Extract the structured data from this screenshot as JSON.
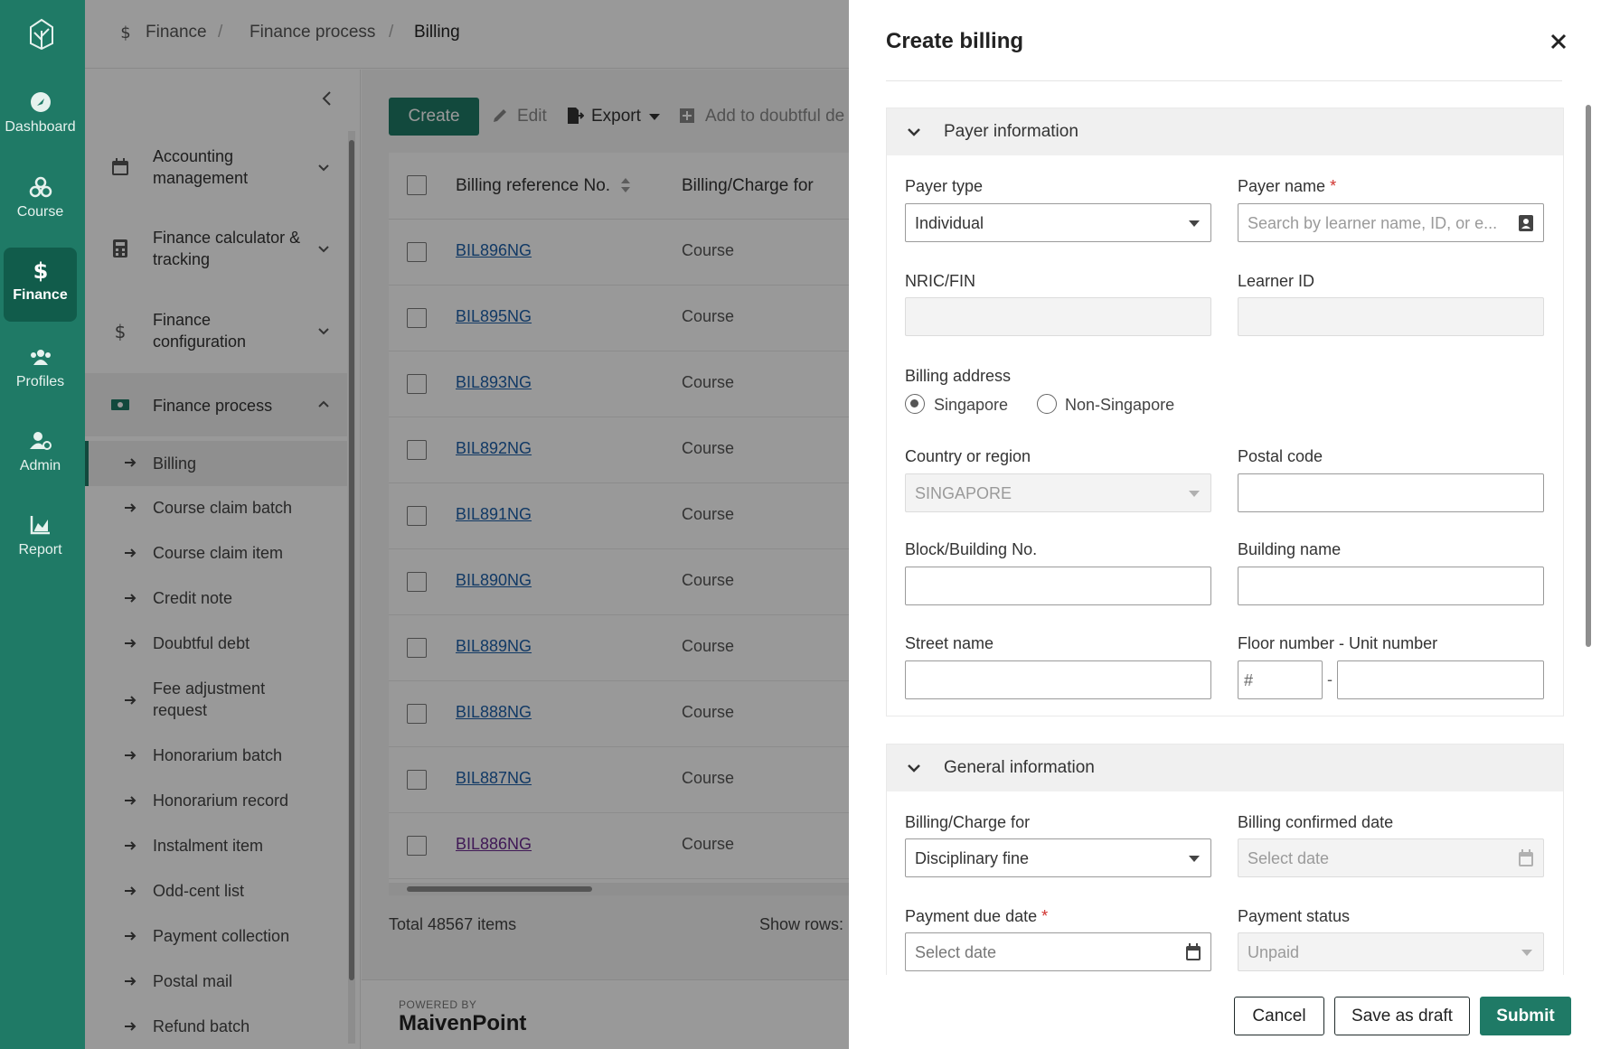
{
  "rail": {
    "items": [
      {
        "label": "Dashboard",
        "icon": "dashboard-icon"
      },
      {
        "label": "Course",
        "icon": "course-icon"
      },
      {
        "label": "Finance",
        "icon": "dollar-icon"
      },
      {
        "label": "Profiles",
        "icon": "people-icon"
      },
      {
        "label": "Admin",
        "icon": "admin-icon"
      },
      {
        "label": "Report",
        "icon": "chart-icon"
      }
    ]
  },
  "breadcrumb": {
    "items": [
      "Finance",
      "Finance process",
      "Billing"
    ],
    "separator": "/"
  },
  "subnav": {
    "groups": [
      {
        "label": "Accounting management"
      },
      {
        "label": "Finance calculator & tracking"
      },
      {
        "label": "Finance configuration"
      },
      {
        "label": "Finance process"
      }
    ],
    "items": [
      "Billing",
      "Course claim batch",
      "Course claim item",
      "Credit note",
      "Doubtful debt",
      "Fee adjustment request",
      "Honorarium batch",
      "Honorarium record",
      "Instalment item",
      "Odd-cent list",
      "Payment collection",
      "Postal mail",
      "Refund batch"
    ]
  },
  "toolbar": {
    "create": "Create",
    "edit": "Edit",
    "export": "Export",
    "doubtful": "Add to doubtful de"
  },
  "table": {
    "columns": [
      "Billing reference No.",
      "Billing/Charge for"
    ],
    "rows": [
      {
        "ref": "BIL896NG",
        "charge": "Course"
      },
      {
        "ref": "BIL895NG",
        "charge": "Course"
      },
      {
        "ref": "BIL893NG",
        "charge": "Course"
      },
      {
        "ref": "BIL892NG",
        "charge": "Course"
      },
      {
        "ref": "BIL891NG",
        "charge": "Course"
      },
      {
        "ref": "BIL890NG",
        "charge": "Course"
      },
      {
        "ref": "BIL889NG",
        "charge": "Course"
      },
      {
        "ref": "BIL888NG",
        "charge": "Course"
      },
      {
        "ref": "BIL887NG",
        "charge": "Course"
      },
      {
        "ref": "BIL886NG",
        "charge": "Course"
      }
    ],
    "total": "Total 48567 items",
    "show_rows": "Show rows:"
  },
  "footer": {
    "powered": "POWERED BY",
    "brand": "MaivenPoint"
  },
  "drawer": {
    "title": "Create billing",
    "payer_section": "Payer information",
    "payer_type_label": "Payer type",
    "payer_type_value": "Individual",
    "payer_name_label": "Payer name",
    "payer_name_placeholder": "Search by learner name, ID, or e...",
    "nric_label": "NRIC/FIN",
    "learner_id_label": "Learner ID",
    "billing_address_label": "Billing address",
    "addr_singapore": "Singapore",
    "addr_non_singapore": "Non-Singapore",
    "country_label": "Country or region",
    "country_value": "SINGAPORE",
    "postal_label": "Postal code",
    "block_label": "Block/Building No.",
    "building_label": "Building name",
    "street_label": "Street name",
    "floor_label": "Floor number - Unit number",
    "floor_prefix": "#",
    "floor_dash": "-",
    "general_section": "General information",
    "charge_for_label": "Billing/Charge for",
    "charge_for_value": "Disciplinary fine",
    "confirmed_label": "Billing confirmed date",
    "confirmed_placeholder": "Select date",
    "due_label": "Payment due date",
    "due_placeholder": "Select date",
    "status_label": "Payment status",
    "status_value": "Unpaid",
    "required_mark": "*",
    "cancel": "Cancel",
    "save_draft": "Save as draft",
    "submit": "Submit"
  },
  "colors": {
    "brand": "#1f7a66",
    "rail": "#1f7a66",
    "link": "#1d5fa8",
    "required": "#d0312d"
  }
}
